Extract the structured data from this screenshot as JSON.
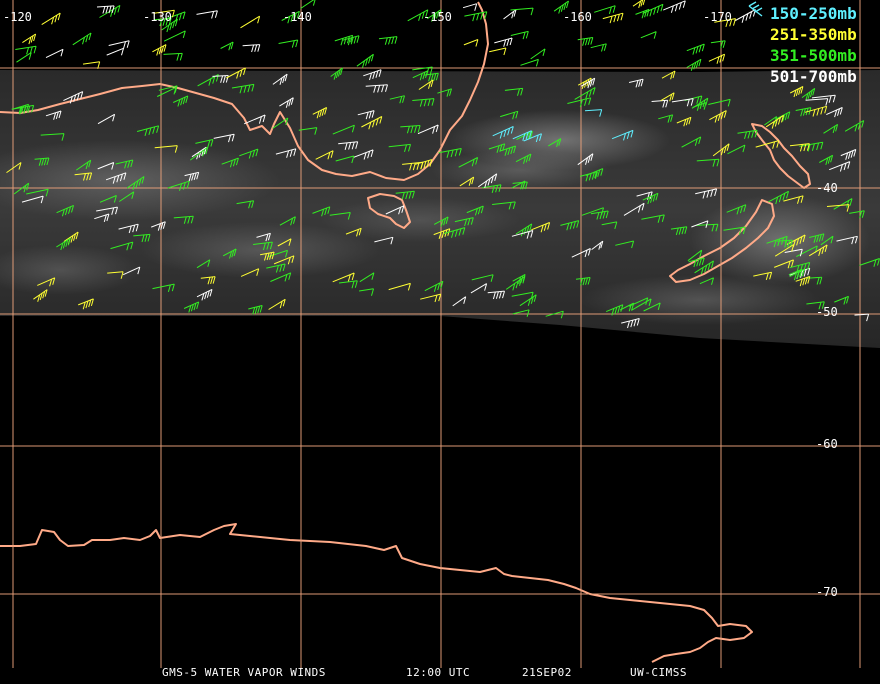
{
  "grid": {
    "longitude_labels": [
      "-120",
      "-130",
      "-140",
      "-150",
      "-160",
      "-170"
    ],
    "latitude_labels": [
      "-40",
      "-50",
      "-60",
      "-70"
    ]
  },
  "legend": [
    {
      "label": "150-250mb",
      "color": "#5ff0ff"
    },
    {
      "label": "251-350mb",
      "color": "#ffff33"
    },
    {
      "label": "351-500mb",
      "color": "#33ee22"
    },
    {
      "label": "501-700mb",
      "color": "#ffffff"
    }
  ],
  "footer": {
    "product": "GMS-5 WATER VAPOR WINDS",
    "time": "12:00 UTC",
    "date": "21SEP02",
    "source": "UW-CIMSS"
  },
  "colors": {
    "grid": "#e8a07a",
    "coastline": "#ffaa88",
    "background": "#000000"
  }
}
